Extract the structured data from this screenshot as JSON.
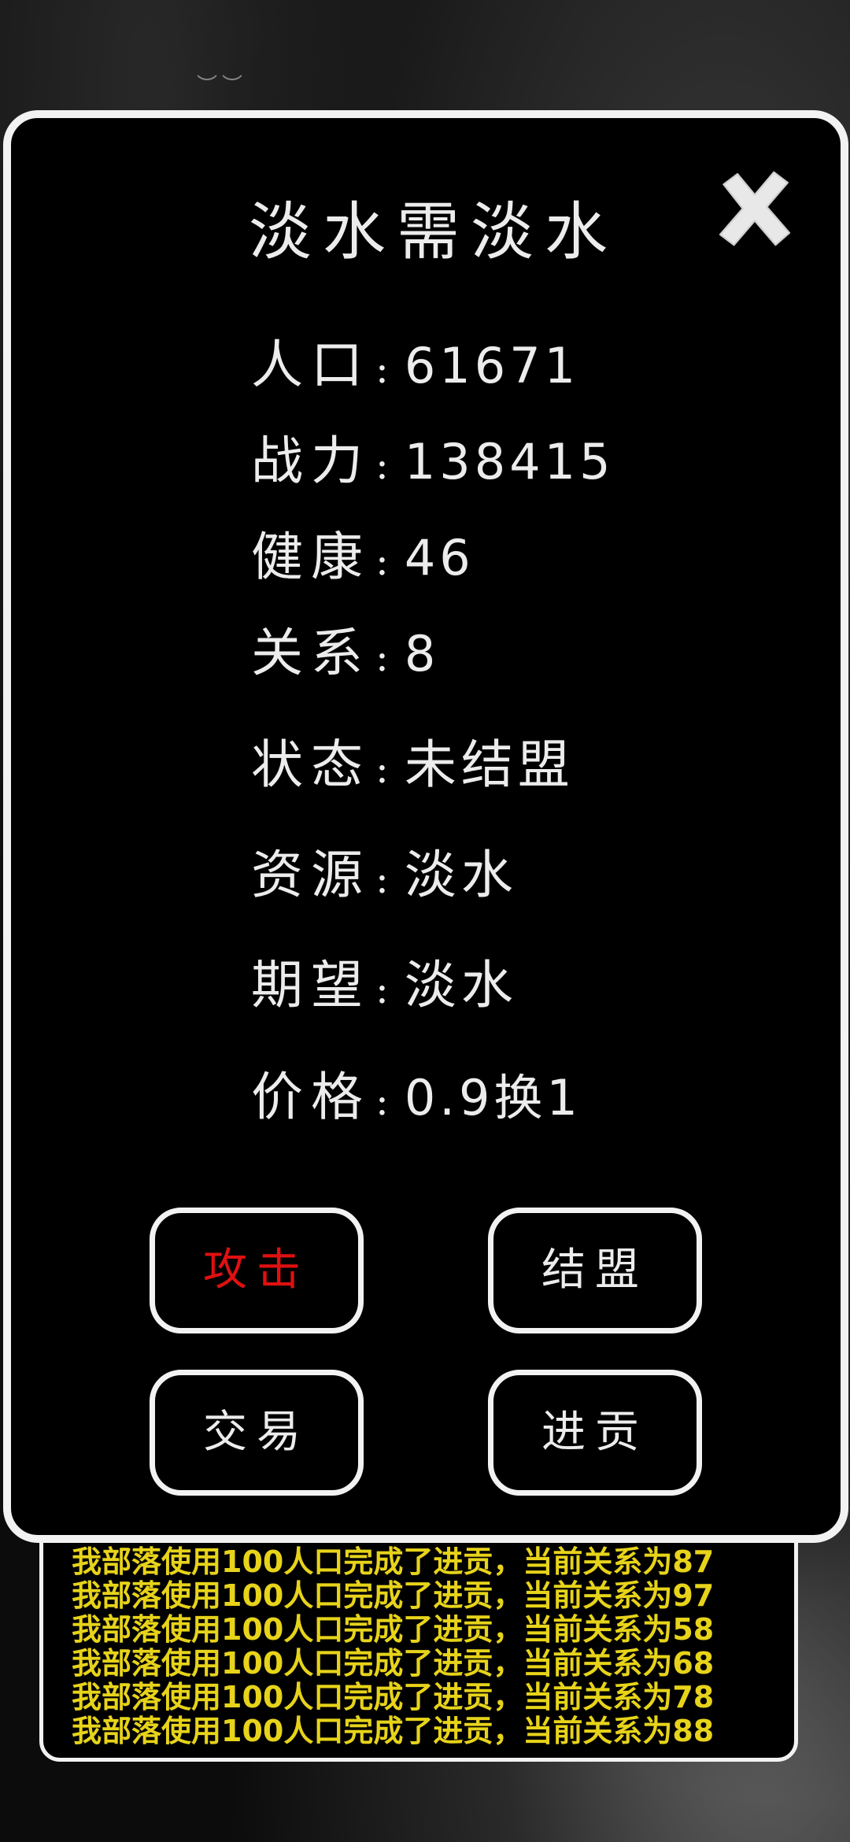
{
  "dialog": {
    "title": "淡水需淡水",
    "close_label": "✕",
    "info": [
      {
        "label": "人口",
        "colon": ":",
        "value": "61671"
      },
      {
        "label": "战力",
        "colon": ":",
        "value": "138415"
      },
      {
        "label": "健康",
        "colon": ":",
        "value": "46"
      },
      {
        "label": "关系",
        "colon": ":",
        "value": "8"
      },
      {
        "label": "状态",
        "colon": ":",
        "value": "未结盟"
      },
      {
        "label": "资源",
        "colon": ":",
        "value": "淡水"
      },
      {
        "label": "期望",
        "colon": ":",
        "value": "淡水"
      },
      {
        "label": "价格",
        "colon": ":",
        "value": "0.9换1"
      }
    ],
    "buttons": {
      "attack": "攻击",
      "alliance": "结盟",
      "trade": "交易",
      "tribute": "进贡"
    }
  },
  "log": [
    "我部落使用100人口完成了进贡，当前关系为87",
    "我部落使用100人口完成了进贡，当前关系为97",
    "我部落使用100人口完成了进贡，当前关系为58",
    "我部落使用100人口完成了进贡，当前关系为68",
    "我部落使用100人口完成了进贡，当前关系为78",
    "我部落使用100人口完成了进贡，当前关系为88"
  ],
  "colors": {
    "attack_text": "#e01010",
    "log_text": "#e7d31a",
    "border": "#f2f2f2",
    "text": "#ececec"
  }
}
